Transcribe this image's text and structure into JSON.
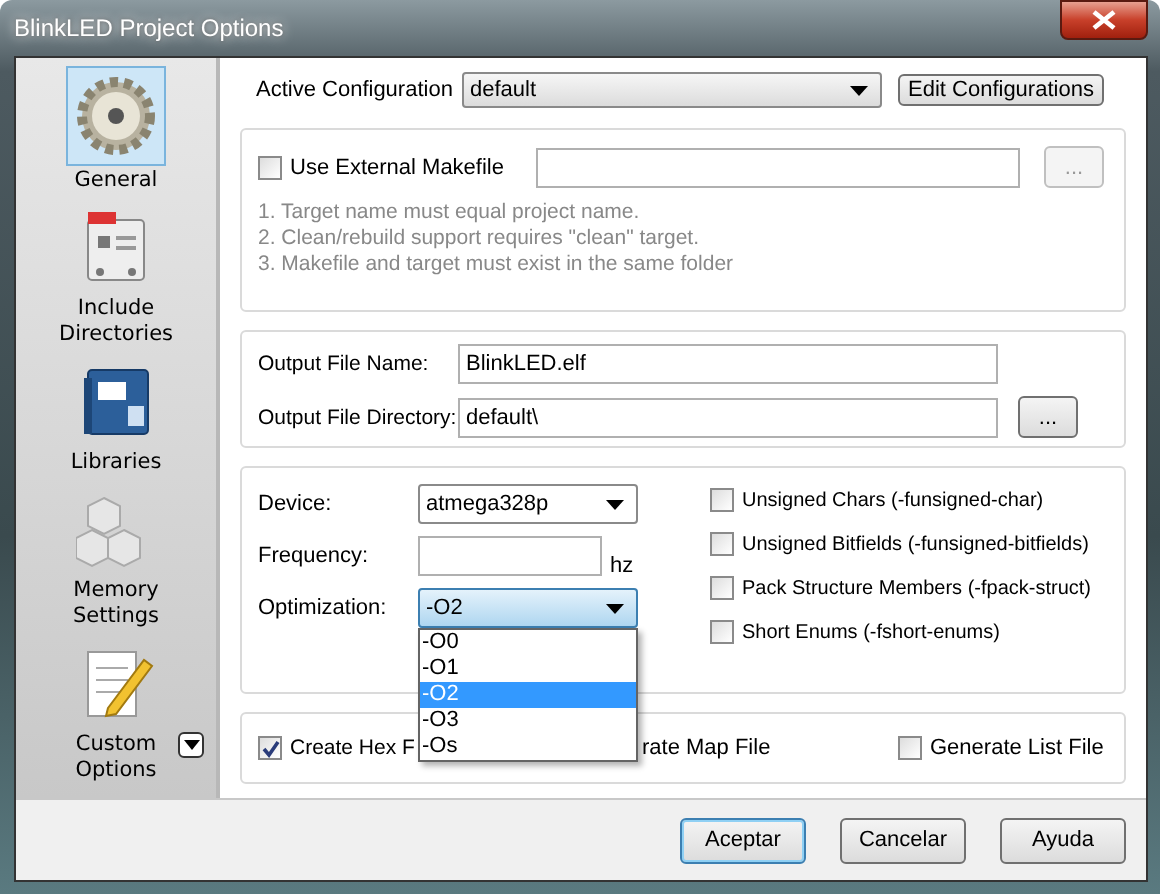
{
  "window": {
    "title": "BlinkLED Project Options"
  },
  "sidebar": {
    "items": [
      {
        "label": "General",
        "kind": "gear",
        "selected": true
      },
      {
        "label": "Include Directories",
        "kind": "card",
        "selected": false
      },
      {
        "label": "Libraries",
        "kind": "book",
        "selected": false
      },
      {
        "label": "Memory Settings",
        "kind": "cubes",
        "selected": false
      },
      {
        "label": "Custom Options",
        "kind": "notepad",
        "selected": false
      }
    ]
  },
  "active_configuration": {
    "label": "Active Configuration",
    "value": "default",
    "button": "Edit Configurations"
  },
  "makefile": {
    "checkbox": {
      "label": "Use External Makefile",
      "checked": false
    },
    "browse_button": {
      "label": "...",
      "disabled": true
    },
    "notes": [
      "1. Target name must equal project name.",
      "2. Clean/rebuild support requires  \"clean\" target.",
      "3. Makefile and target must exist in the same folder"
    ]
  },
  "output": {
    "fields": [
      {
        "label": "Output File Name:",
        "value": "BlinkLED.elf"
      },
      {
        "label": "Output File Directory:",
        "value": "default\\",
        "browse": "..."
      }
    ]
  },
  "device": {
    "label": "Device:",
    "value": "atmega328p"
  },
  "frequency": {
    "label": "Frequency:",
    "unit": "hz"
  },
  "optimization": {
    "label": "Optimization:",
    "value": "-O2",
    "expanded": true,
    "options": [
      {
        "label": "-O0",
        "selected": false
      },
      {
        "label": "-O1",
        "selected": false
      },
      {
        "label": "-O2",
        "selected": true
      },
      {
        "label": "-O3",
        "selected": false
      },
      {
        "label": "-Os",
        "selected": false
      }
    ]
  },
  "flags": [
    {
      "label": "Unsigned Chars (-funsigned-char)",
      "checked": false
    },
    {
      "label": "Unsigned Bitfields (-funsigned-bitfields)",
      "checked": false
    },
    {
      "label": "Pack Structure Members (-fpack-struct)",
      "checked": false
    },
    {
      "label": "Short Enums (-fshort-enums)",
      "checked": false
    }
  ],
  "outputs": [
    {
      "kind": "checkbox",
      "label": "Create Hex F",
      "checked": true
    },
    {
      "kind": "text",
      "label": "rate Map File"
    },
    {
      "kind": "checkbox",
      "label": "Generate List File",
      "checked": false
    }
  ],
  "buttons": [
    {
      "label": "Aceptar",
      "default": true
    },
    {
      "label": "Cancelar",
      "default": false
    },
    {
      "label": "Ayuda",
      "default": false
    }
  ]
}
